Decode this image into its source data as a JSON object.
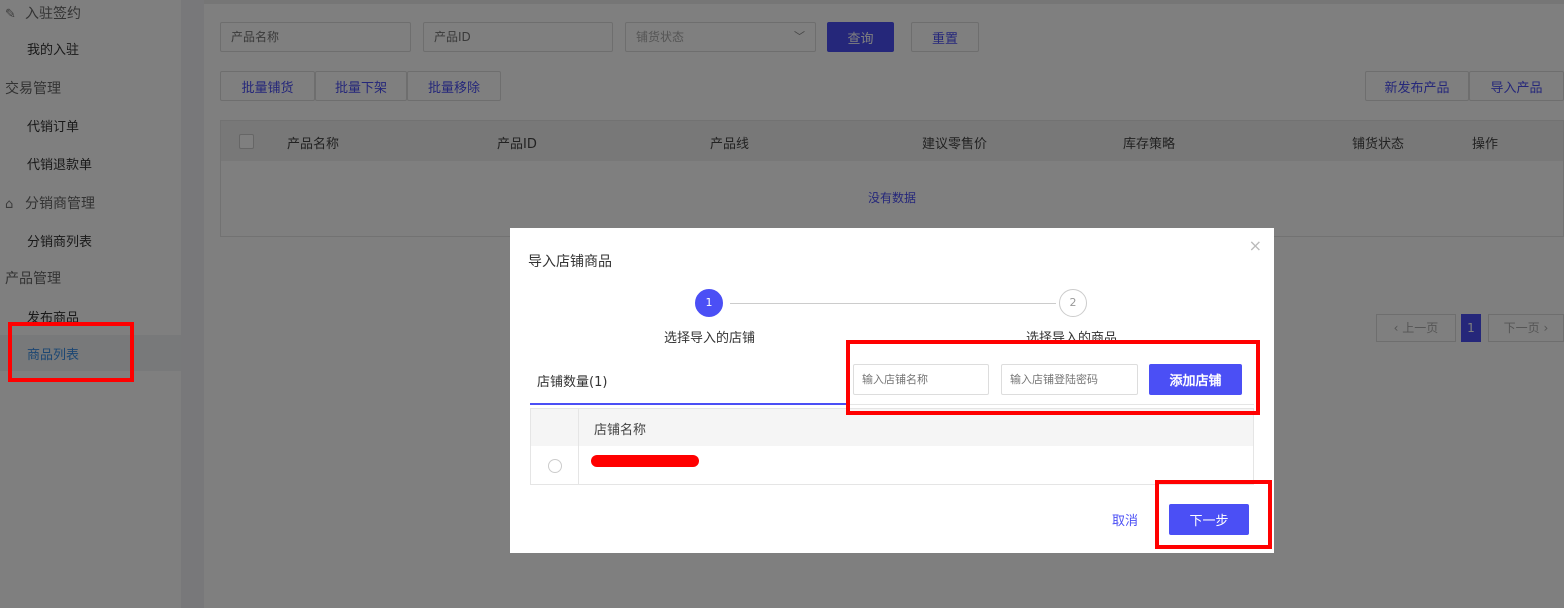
{
  "sidebar": {
    "group_signing": "入驻签约",
    "my_signing": "我的入驻",
    "group_trade": "交易管理",
    "consign_orders": "代销订单",
    "consign_refunds": "代销退款单",
    "group_distributor": "分销商管理",
    "distributor_list": "分销商列表",
    "group_product": "产品管理",
    "publish_product": "发布商品",
    "product_list": "商品列表"
  },
  "filters": {
    "product_name_placeholder": "产品名称",
    "product_id_placeholder": "产品ID",
    "status_select": "铺货状态",
    "query_button": "查询",
    "reset_button": "重置"
  },
  "toolbar": {
    "batch_distribute": "批量铺货",
    "batch_offshelf": "批量下架",
    "batch_remove": "批量移除",
    "new_product": "新发布产品",
    "import_product": "导入产品"
  },
  "table": {
    "headers": [
      "产品名称",
      "产品ID",
      "产品线",
      "建议零售价",
      "库存策略",
      "铺货状态",
      "操作"
    ],
    "empty_text": "没有数据"
  },
  "pagination": {
    "prev": "上一页",
    "current": "1",
    "next": "下一页"
  },
  "modal": {
    "title": "导入店铺商品",
    "close": "×",
    "steps": [
      {
        "number": "1",
        "label": "选择导入的店铺"
      },
      {
        "number": "2",
        "label": "选择导入的商品"
      }
    ],
    "tab_label": "店铺数量(1)",
    "store_name_placeholder": "输入店铺名称",
    "store_password_placeholder": "输入店铺登陆密码",
    "add_store_button": "添加店铺",
    "column_store_name": "店铺名称",
    "cancel_button": "取消",
    "next_button": "下一步"
  },
  "colors": {
    "accent": "#4b4ff5",
    "highlight": "#ff0000",
    "link": "#3a8ee6"
  }
}
